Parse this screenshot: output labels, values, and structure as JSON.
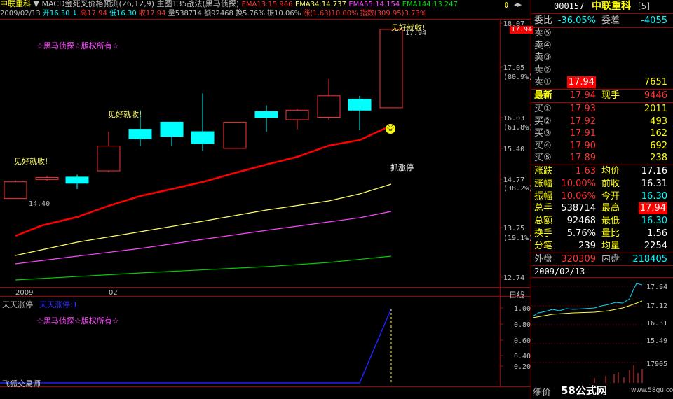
{
  "title_bar": {
    "stock_name": "中联重科",
    "formula": "MACD金死叉价格预测(26,12,9)",
    "main_chart": "主图135战法(黑马侦探)",
    "ema13": "EMA13:15.966",
    "ema34": "EMA34:14.737",
    "ema55": "EMA55:14.154",
    "ema144": "EMA144:13.247"
  },
  "info_bar": {
    "date": "2009/02/13",
    "open": "开16.30",
    "high": "高17.94",
    "low": "低16.30",
    "close": "收17.94",
    "volume": "量538714",
    "amount": "额92468",
    "turnover": "换5.76%",
    "amplitude": "振10.06%",
    "change": "涨(1.63)10.00%",
    "index": "指数(309.95)3.73%"
  },
  "chart": {
    "watermark": "☆黑马侦探☆版权所有☆",
    "annotations": {
      "take_profit": "见好就收!",
      "limit_up": "抓涨停",
      "low_label": "14.40",
      "high_label": "17.94"
    },
    "x_labels": [
      "2009",
      "02"
    ],
    "y_labels": [
      "18.07",
      "17.05",
      "(80.9%)",
      "16.03",
      "(61.8%)",
      "15.40",
      "14.77",
      "(38.2%)",
      "13.75",
      "(19.1%)",
      "12.74"
    ],
    "current_price_tag": "17.94",
    "period": "日线",
    "colors": {
      "up": "#ff3232",
      "down": "#00ffff",
      "ema13": "#ff0000",
      "ema34": "#ffff66",
      "ema55": "#ff44ff",
      "ema144": "#00d000"
    }
  },
  "sub_chart": {
    "title": "天天涨停",
    "indicator": "天天涨停:1",
    "watermark": "☆黑马侦探☆版权所有☆",
    "signature": "飞狐交易师",
    "y_labels": [
      "1.00",
      "0.80",
      "0.60",
      "0.40",
      "0.20"
    ]
  },
  "right_panel": {
    "code": "000157",
    "name": "中联重科",
    "badge": "[5]",
    "wei_bi_label": "委比",
    "wei_bi": "-36.05%",
    "wei_cha_label": "委差",
    "wei_cha": "-4055",
    "asks": [
      {
        "label": "卖⑤",
        "price": "",
        "vol": ""
      },
      {
        "label": "卖④",
        "price": "",
        "vol": ""
      },
      {
        "label": "卖③",
        "price": "",
        "vol": ""
      },
      {
        "label": "卖②",
        "price": "",
        "vol": ""
      },
      {
        "label": "卖①",
        "price": "17.94",
        "vol": "7651"
      }
    ],
    "latest_label": "最新",
    "latest": "17.94",
    "now_hand_label": "现手",
    "now_hand": "9446",
    "bids": [
      {
        "label": "买①",
        "price": "17.93",
        "vol": "2011"
      },
      {
        "label": "买②",
        "price": "17.92",
        "vol": "493"
      },
      {
        "label": "买③",
        "price": "17.91",
        "vol": "162"
      },
      {
        "label": "买④",
        "price": "17.90",
        "vol": "692"
      },
      {
        "label": "买⑤",
        "price": "17.89",
        "vol": "238"
      }
    ],
    "stats": [
      {
        "l1": "涨跌",
        "v1": "1.63",
        "l2": "均价",
        "v2": "17.16"
      },
      {
        "l1": "涨幅",
        "v1": "10.00%",
        "l2": "前收",
        "v2": "16.31"
      },
      {
        "l1": "振幅",
        "v1": "10.06%",
        "l2": "今开",
        "v2": "16.30"
      },
      {
        "l1": "总手",
        "v1": "538714",
        "l2": "最高",
        "v2": "17.94"
      },
      {
        "l1": "总额",
        "v1": "92468",
        "l2": "最低",
        "v2": "16.30"
      },
      {
        "l1": "换手",
        "v1": "5.76%",
        "l2": "量比",
        "v2": "1.56"
      },
      {
        "l1": "分笔",
        "v1": "239",
        "l2": "均量",
        "v2": "2254"
      }
    ],
    "outer_label": "外盘",
    "outer": "320309",
    "inner_label": "内盘",
    "inner": "218405",
    "mini_date": "2009/02/13",
    "mini_y": [
      "17.94",
      "17.12",
      "16.31",
      "15.49"
    ],
    "mini_vol": "17905",
    "bottom_label": "细价",
    "site_logo": "58公式网",
    "site_url": "www.58gu.com"
  }
}
